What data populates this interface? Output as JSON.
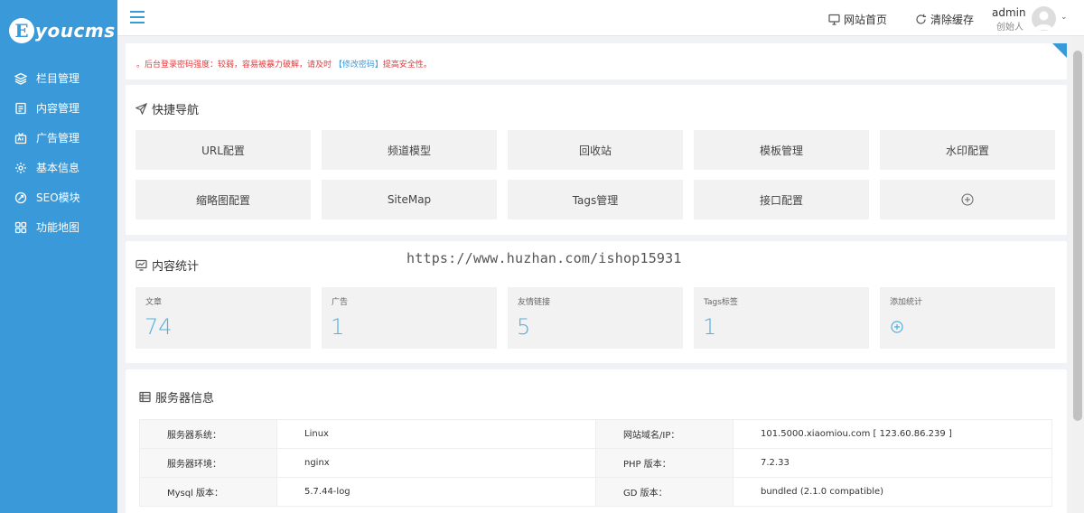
{
  "brand": {
    "badge": "E",
    "text": "youcms"
  },
  "sidebar": {
    "items": [
      {
        "label": "栏目管理",
        "icon": "layers-icon"
      },
      {
        "label": "内容管理",
        "icon": "document-icon"
      },
      {
        "label": "广告管理",
        "icon": "ad-icon"
      },
      {
        "label": "基本信息",
        "icon": "gear-icon"
      },
      {
        "label": "SEO模块",
        "icon": "seo-icon"
      },
      {
        "label": "功能地图",
        "icon": "grid-icon"
      }
    ]
  },
  "topbar": {
    "home_label": "网站首页",
    "clear_cache_label": "清除缓存",
    "user_name": "admin",
    "user_role": "创始人"
  },
  "notice": {
    "prefix": "。后台登录密码强度：较弱，容易被暴力破解，请及时",
    "link": "【修改密码】",
    "suffix": "提高安全性。"
  },
  "quick_nav": {
    "title": "快捷导航",
    "buttons": [
      "URL配置",
      "频道模型",
      "回收站",
      "模板管理",
      "水印配置",
      "缩略图配置",
      "SiteMap",
      "Tags管理",
      "接口配置"
    ]
  },
  "stats": {
    "title": "内容统计",
    "cards": [
      {
        "label": "文章",
        "value": "74"
      },
      {
        "label": "广告",
        "value": "1"
      },
      {
        "label": "友情链接",
        "value": "5"
      },
      {
        "label": "Tags标签",
        "value": "1"
      }
    ],
    "add_label": "添加统计"
  },
  "server": {
    "title": "服务器信息",
    "rows": [
      {
        "k1": "服务器系统：",
        "v1": "Linux",
        "k2": "网站域名/IP：",
        "v2": "101.5000.xiaomiou.com [ 123.60.86.239 ]"
      },
      {
        "k1": "服务器环境：",
        "v1": "nginx",
        "k2": "PHP 版本：",
        "v2": "7.2.33"
      },
      {
        "k1": "Mysql 版本：",
        "v1": "5.7.44-log",
        "k2": "GD 版本：",
        "v2": "bundled (2.1.0 compatible)"
      }
    ]
  },
  "watermark": "https://www.huzhan.com/ishop15931",
  "colors": {
    "accent": "#3a9ad9",
    "stat_value": "#4fb0e0",
    "warning": "#e4393c"
  }
}
